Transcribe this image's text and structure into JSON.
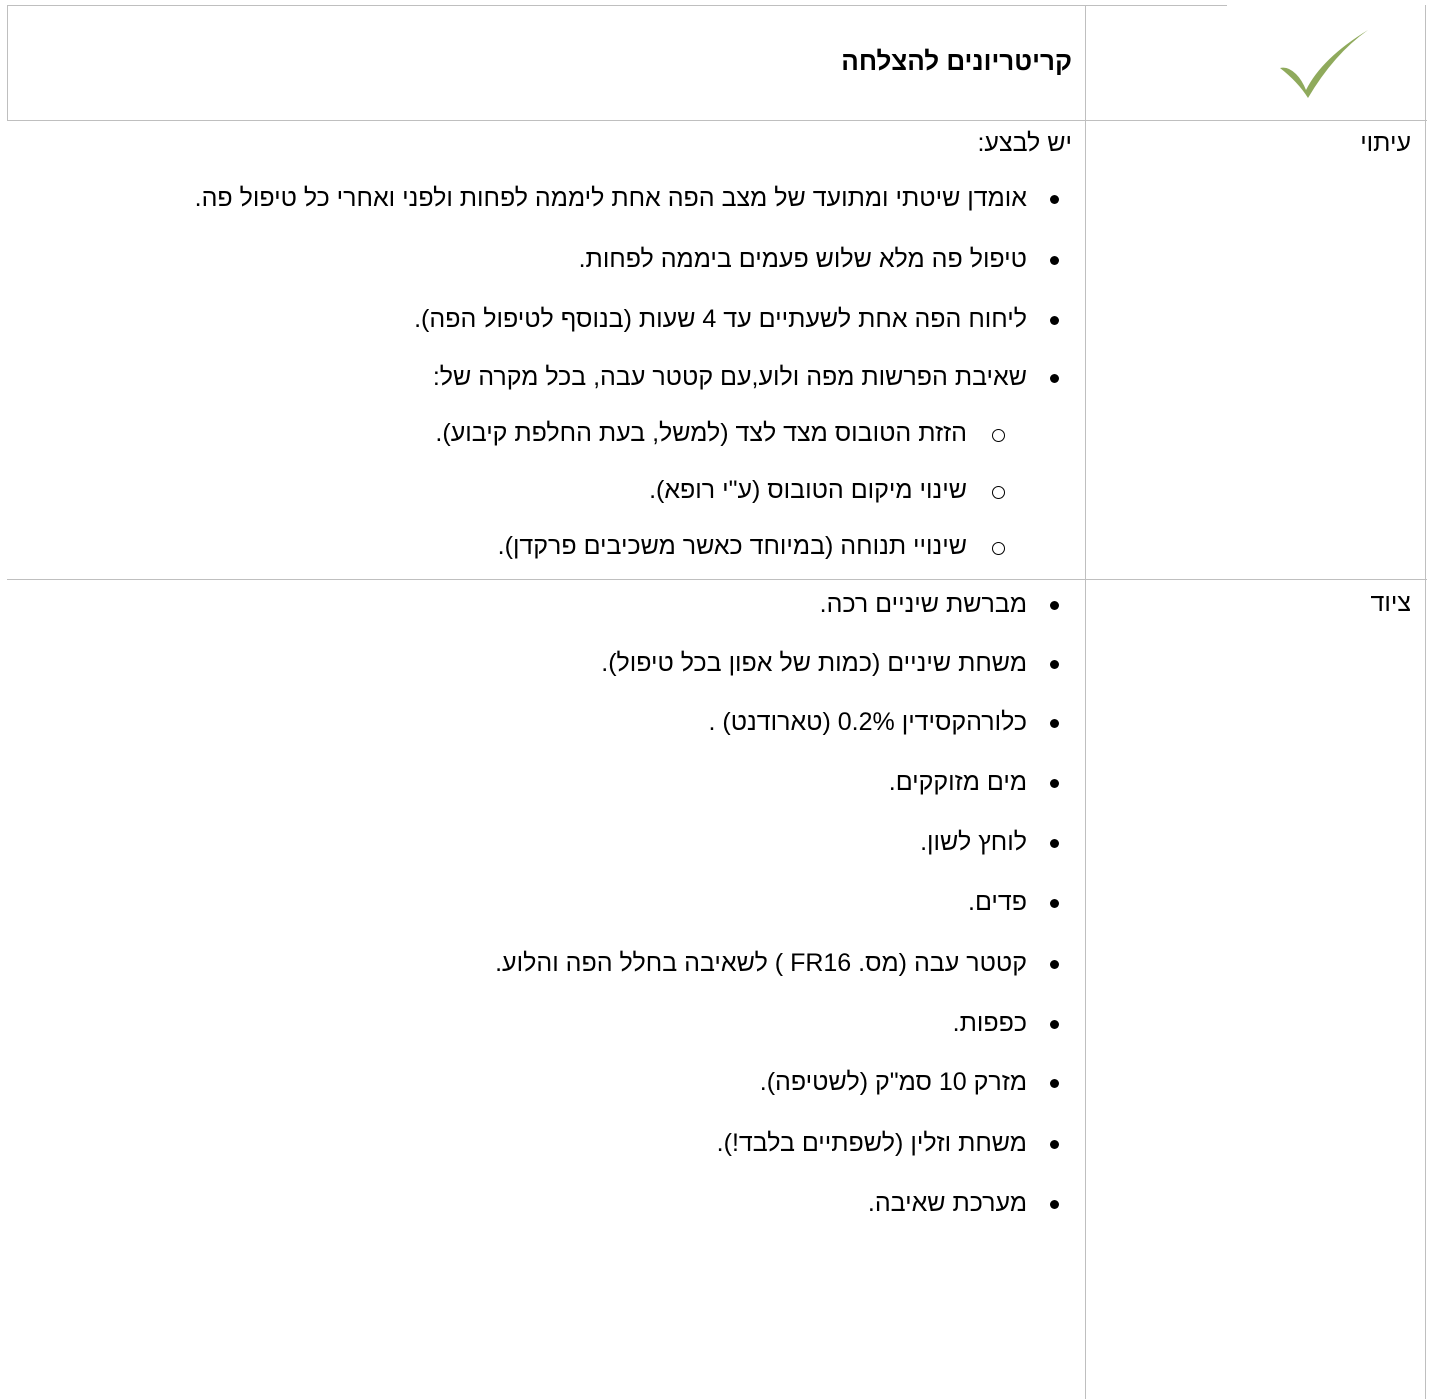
{
  "header": {
    "title": "קריטריונים להצלחה"
  },
  "icons": {
    "check_icon": "check-icon",
    "check_color": "#8faa5c"
  },
  "timing": {
    "label": "עיתוי",
    "intro": "יש לבצע:",
    "items": [
      "אומדן שיטתי ומתועד של מצב הפה אחת ליממה לפחות ולפני ואחרי כל טיפול פה.",
      "טיפול פה מלא שלוש פעמים ביממה לפחות.",
      "ליחוח הפה אחת לשעתיים עד 4 שעות (בנוסף לטיפול הפה).",
      "שאיבת הפרשות מפה ולוע,עם קטטר עבה, בכל מקרה של:"
    ],
    "subitems": [
      "הזזת הטובוס מצד לצד (למשל, בעת החלפת קיבוע).",
      "שינוי מיקום הטובוס (ע\"י רופא).",
      "שינויי תנוחה (במיוחד כאשר משכיבים פרקדן)."
    ]
  },
  "equipment": {
    "label": "ציוד",
    "items": [
      "מברשת שיניים רכה.",
      "משחת שיניים (כמות של אפון בכל טיפול).",
      "כלורהקסידין 0.2% (טארודנט) .",
      "מים מזוקקים.",
      "לוחץ לשון.",
      "פדים.",
      "קטטר עבה (מס. FR16 ) לשאיבה בחלל הפה והלוע.",
      "כפפות.",
      "מזרק 10 סמ\"ק (לשטיפה).",
      "משחת וזלין (לשפתיים בלבד!).",
      "מערכת שאיבה."
    ]
  }
}
